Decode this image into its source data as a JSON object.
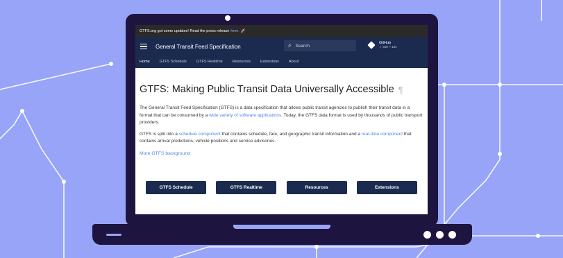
{
  "banner": {
    "prefix": "GTFS.org got some updates! Read the press release",
    "link": "here.",
    "emoji": "🚀"
  },
  "header": {
    "title": "General Transit Feed Specification",
    "search_placeholder": "Search",
    "github": {
      "label": "GitHub",
      "stars": "☆ 310",
      "forks": "⑂ 134"
    }
  },
  "tabs": [
    {
      "label": "Home"
    },
    {
      "label": "GTFS Schedule"
    },
    {
      "label": "GTFS Realtime"
    },
    {
      "label": "Resources"
    },
    {
      "label": "Extensions"
    },
    {
      "label": "About"
    }
  ],
  "content": {
    "heading": "GTFS: Making Public Transit Data Universally Accessible",
    "pilcrow": "¶",
    "para1": {
      "before": "The General Transit Feed Specification (GTFS) is a data specification that allows public transit agencies to publish their transit data in a format that can be consumed by a",
      "link": "wide variety of software applications",
      "after": ". Today, the GTFS data format is used by thousands of public transport providers."
    },
    "para2": {
      "a": "GTFS is split into a",
      "link1": "schedule component",
      "b": "that contains schedule, fare, and geographic transit information and a",
      "link2": "real-time component",
      "c": "that contains arrival predictions, vehicle positions and service advisories."
    },
    "more_link": "More GTFS background"
  },
  "buttons": [
    {
      "label": "GTFS Schedule"
    },
    {
      "label": "GTFS Realtime"
    },
    {
      "label": "Resources"
    },
    {
      "label": "Extensions"
    }
  ],
  "colors": {
    "background": "#98a4f7",
    "laptop": "#1d1540",
    "nav": "#1b2b4f",
    "link": "#4a86e8"
  }
}
